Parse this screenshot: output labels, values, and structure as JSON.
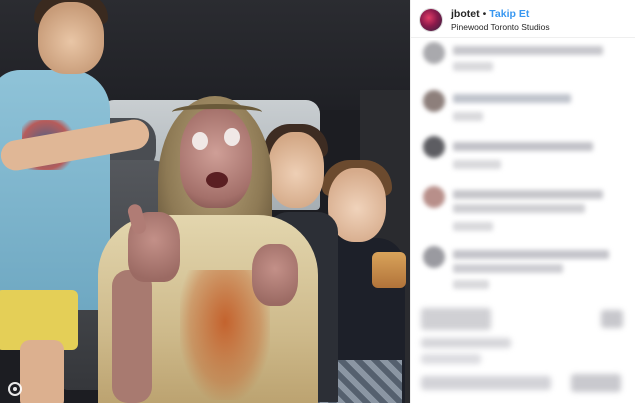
{
  "post": {
    "username": "jbotet",
    "separator": "•",
    "follow_label": "Takip Et",
    "location": "Pinewood Toronto Studios"
  },
  "colors": {
    "follow_blue": "#3897f0",
    "text": "#262626",
    "divider": "#efefef"
  },
  "icons": {
    "avatar": "profile-avatar",
    "multi": "user-tags-icon"
  },
  "comments_blurred": true
}
